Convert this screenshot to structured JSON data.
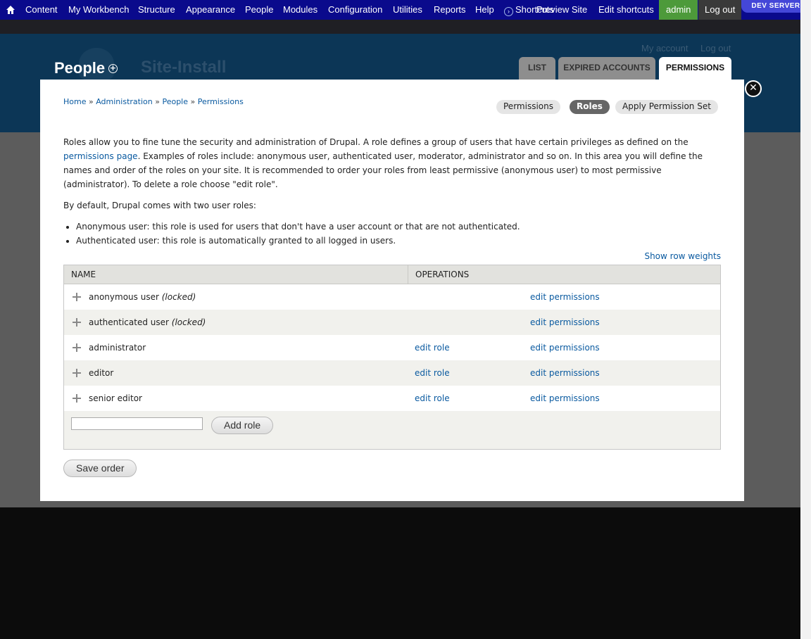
{
  "toolbar": {
    "items": [
      "Content",
      "My Workbench",
      "Structure",
      "Appearance",
      "People",
      "Modules",
      "Configuration",
      "Utilities",
      "Reports",
      "Help"
    ],
    "shortcuts_label": "Shortcuts",
    "preview_label": "Preview Site",
    "edit_shortcuts_label": "Edit shortcuts",
    "user_label": "admin",
    "logout_label": "Log out",
    "env_badge": "DEV SERVER"
  },
  "header": {
    "secondary_links": [
      "My account",
      "Log out"
    ],
    "page_title": "People",
    "site_name": "Site-Install",
    "tabs": [
      {
        "label": "List",
        "active": false
      },
      {
        "label": "Expired accounts",
        "active": false
      },
      {
        "label": "Permissions",
        "active": true
      }
    ]
  },
  "overlay": {
    "breadcrumb": [
      "Home",
      "Administration",
      "People",
      "Permissions"
    ],
    "breadcrumb_separator": " » ",
    "secondary_tabs": [
      {
        "label": "Permissions",
        "active": false
      },
      {
        "label": "Roles",
        "active": true
      },
      {
        "label": "Apply Permission Set",
        "active": false
      }
    ],
    "intro_before_link": "Roles allow you to fine tune the security and administration of Drupal. A role defines a group of users that have certain privileges as defined on the ",
    "intro_link": "permissions page",
    "intro_after_link": ". Examples of roles include: anonymous user, authenticated user, moderator, administrator and so on. In this area you will define the names and order of the roles on your site. It is recommended to order your roles from least permissive (anonymous user) to most permissive (administrator). To delete a role choose \"edit role\".",
    "default_roles_intro": "By default, Drupal comes with two user roles:",
    "default_roles": [
      "Anonymous user: this role is used for users that don't have a user account or that are not authenticated.",
      "Authenticated user: this role is automatically granted to all logged in users."
    ],
    "show_row_weights": "Show row weights",
    "table": {
      "headers": [
        "Name",
        "Operations"
      ],
      "edit_role_label": "edit role",
      "edit_permissions_label": "edit permissions",
      "locked_label": "(locked)",
      "rows": [
        {
          "name": "anonymous user",
          "locked": true
        },
        {
          "name": "authenticated user",
          "locked": true
        },
        {
          "name": "administrator",
          "locked": false
        },
        {
          "name": "editor",
          "locked": false
        },
        {
          "name": "senior editor",
          "locked": false
        }
      ]
    },
    "new_role_value": "",
    "add_role_label": "Add role",
    "save_order_label": "Save order"
  }
}
